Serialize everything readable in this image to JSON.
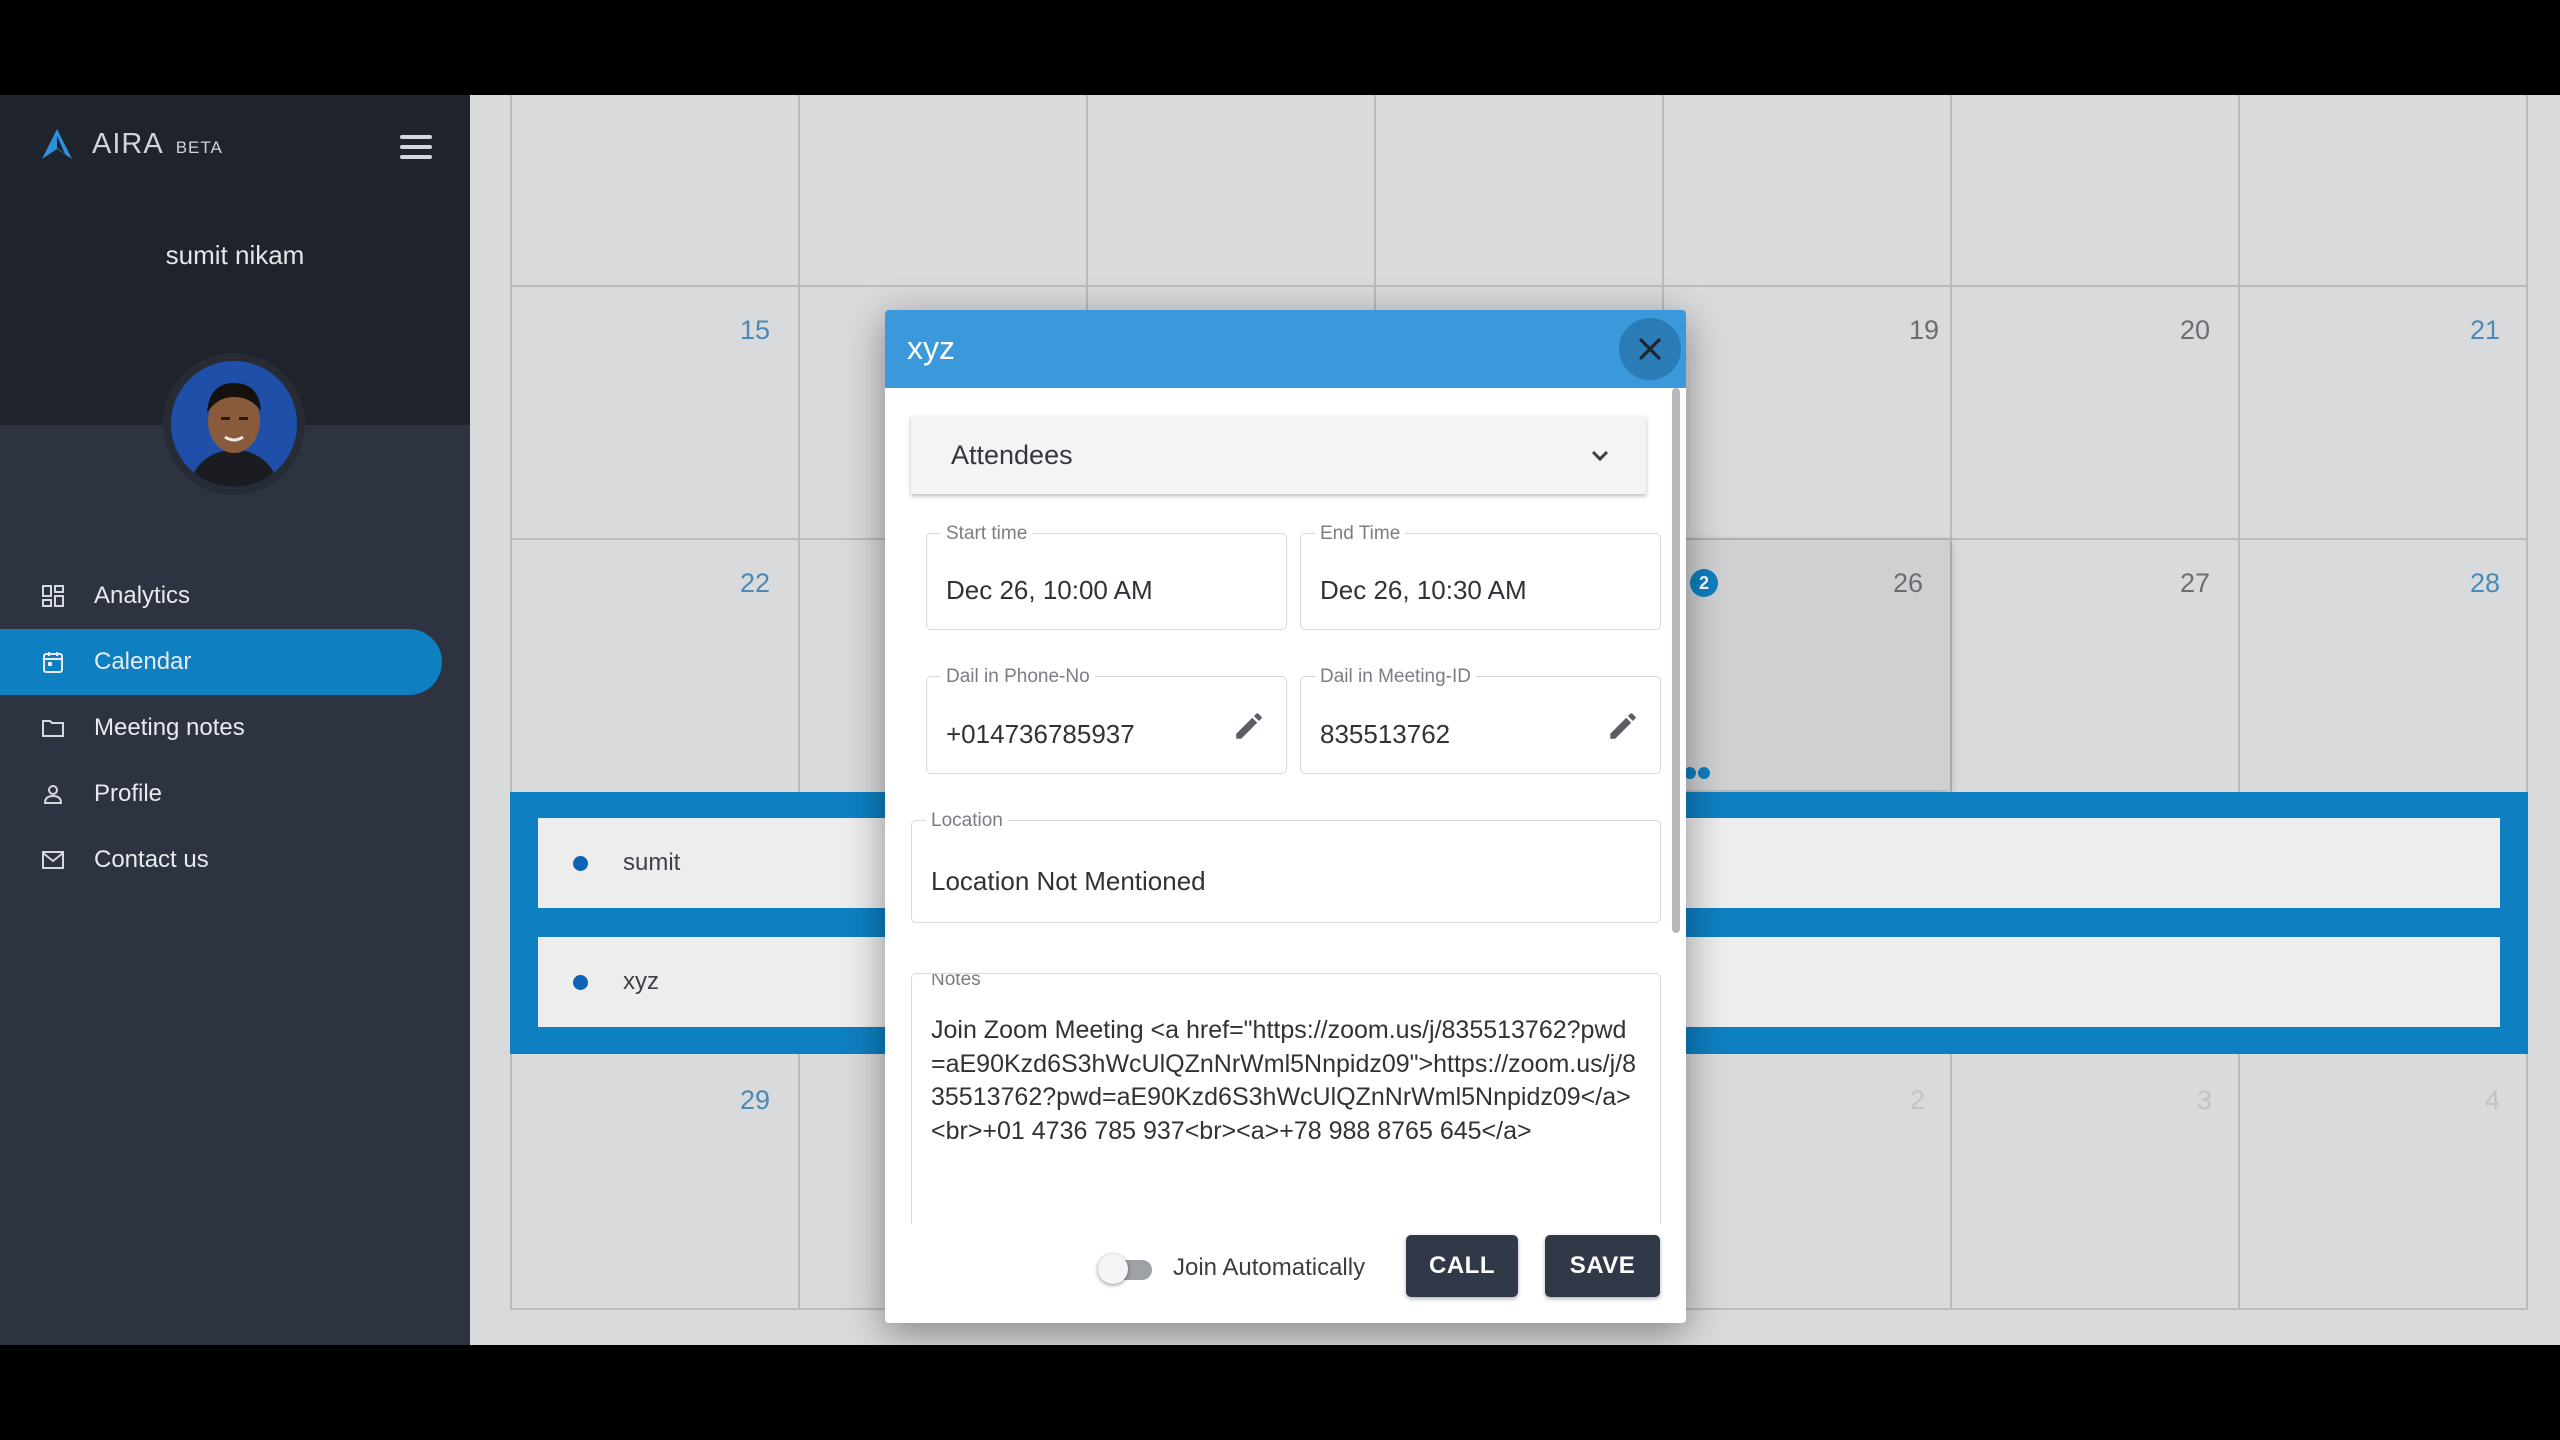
{
  "brand": {
    "name": "AIRA",
    "tag": "BETA",
    "accent": "#0e7fc1"
  },
  "user": {
    "name": "sumit nikam"
  },
  "sidebar": {
    "items": [
      {
        "label": "Analytics",
        "icon": "dashboard-icon",
        "active": false
      },
      {
        "label": "Calendar",
        "icon": "calendar-icon",
        "active": true
      },
      {
        "label": "Meeting notes",
        "icon": "folder-icon",
        "active": false
      },
      {
        "label": "Profile",
        "icon": "person-icon",
        "active": false
      },
      {
        "label": "Contact us",
        "icon": "mail-icon",
        "active": false
      }
    ]
  },
  "calendar": {
    "week2": [
      "15",
      "19",
      "20",
      "21"
    ],
    "week3": [
      "22",
      "26",
      "27",
      "28"
    ],
    "week4": [
      "29",
      "2",
      "3",
      "4"
    ],
    "badge_count": "2",
    "events": [
      {
        "label": "sumit"
      },
      {
        "label": "xyz"
      }
    ]
  },
  "modal": {
    "title": "xyz",
    "attendees_label": "Attendees",
    "start_time": {
      "label": "Start time",
      "value": "Dec 26, 10:00 AM"
    },
    "end_time": {
      "label": "End Time",
      "value": "Dec 26, 10:30 AM"
    },
    "phone": {
      "label": "Dail in Phone-No",
      "value": "+014736785937"
    },
    "meeting_id": {
      "label": "Dail in Meeting-ID",
      "value": "835513762"
    },
    "location": {
      "label": "Location",
      "value": "Location Not Mentioned"
    },
    "notes": {
      "label": "Notes",
      "value": "Join Zoom Meeting <a href=\"https://zoom.us/j/835513762?pwd=aE90Kzd6S3hWcUlQZnNrWml5Nnpidz09\">https://zoom.us/j/835513762?pwd=aE90Kzd6S3hWcUlQZnNrWml5Nnpidz09</a><br>+01 4736 785 937<br><a>+78 988 8765 645</a>"
    },
    "join_auto_label": "Join Automatically",
    "join_auto_on": false,
    "call_label": "CALL",
    "save_label": "SAVE"
  }
}
